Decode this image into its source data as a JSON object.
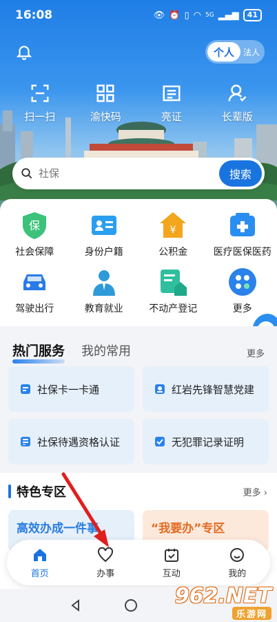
{
  "status": {
    "time": "16:08",
    "battery": "41",
    "network": "5G"
  },
  "header": {
    "mode_toggle": {
      "active": "个人",
      "inactive": "法人"
    }
  },
  "quick_actions": [
    {
      "label": "扫一扫",
      "icon": "scan-icon"
    },
    {
      "label": "渝快码",
      "icon": "qr-code-icon"
    },
    {
      "label": "亮证",
      "icon": "id-card-icon"
    },
    {
      "label": "长辈版",
      "icon": "elder-icon"
    }
  ],
  "search": {
    "placeholder": "社保",
    "button": "搜索"
  },
  "services": [
    {
      "label": "社会保障",
      "icon": "social-security-icon",
      "color": "#3cc27a"
    },
    {
      "label": "身份户籍",
      "icon": "household-icon",
      "color": "#2a9ef0"
    },
    {
      "label": "公积金",
      "icon": "housing-fund-icon",
      "color": "#f3a51d"
    },
    {
      "label": "医疗医保医药",
      "icon": "medical-icon",
      "color": "#2a8ef0"
    },
    {
      "label": "驾驶出行",
      "icon": "car-icon",
      "color": "#2a7ae8"
    },
    {
      "label": "教育就业",
      "icon": "education-icon",
      "color": "#2f9ad8"
    },
    {
      "label": "不动产登记",
      "icon": "property-icon",
      "color": "#2fbf9e"
    },
    {
      "label": "更多",
      "icon": "more-icon",
      "color": "#2a82ea"
    }
  ],
  "hot": {
    "tab_active": "热门服务",
    "tab_other": "我的常用",
    "more": "更多",
    "cards": [
      {
        "label": "社保卡一卡通"
      },
      {
        "label": "红岩先锋智慧党建"
      },
      {
        "label": "社保待遇资格认证"
      },
      {
        "label": "无犯罪记录证明"
      }
    ]
  },
  "featured": {
    "title": "特色专区",
    "more": "更多",
    "left": "高效办成一件事",
    "right": "“我要办”专区"
  },
  "tabbar": [
    {
      "label": "首页",
      "icon": "home-icon",
      "active": true
    },
    {
      "label": "办事",
      "icon": "heart-icon",
      "active": false
    },
    {
      "label": "互动",
      "icon": "calendar-check-icon",
      "active": false
    },
    {
      "label": "我的",
      "icon": "smile-icon",
      "active": false
    }
  ],
  "watermark": {
    "brand": "962.NET",
    "sub": "乐游网"
  },
  "colors": {
    "accent": "#1a74e0",
    "arrow": "#e01e1e"
  }
}
